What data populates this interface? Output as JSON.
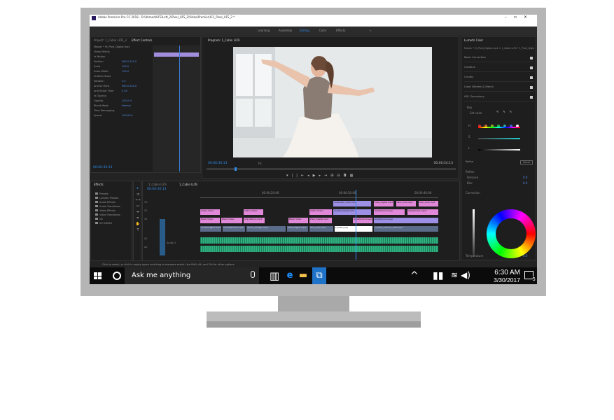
{
  "premiere": {
    "title": "Adobe Premiere Pro CC 2018 - D:\\Ahmed\\UFS\\Left_2\\Pixel_UFS_2\\Video\\Premier\\ICC_Pixel_UFS_2 *",
    "menu": [
      "File",
      "Edit",
      "Clip",
      "Sequence",
      "Markers",
      "Graphics",
      "Window",
      "Help"
    ],
    "workspaces": [
      "Learning",
      "Assembly",
      "Editing",
      "Color",
      "Effects"
    ],
    "active_workspace": "Editing",
    "effect_controls": {
      "tabs": [
        "Project: 1_Cabin LUTs_2",
        "Effect Controls"
      ],
      "source": "Master * Hi_Pixel_Digital.mp4",
      "sequence": "1_Cabin LUTs * 1_...",
      "clip_label": "Pixel_Digital_ICC.mp4",
      "rows": [
        {
          "label": "Video Effects",
          "value": ""
        },
        {
          "label": "fx Motion",
          "value": ""
        },
        {
          "label": "Position",
          "value": "960.0  540.0"
        },
        {
          "label": "Scale",
          "value": "100.0"
        },
        {
          "label": "Scale Width",
          "value": "100.0"
        },
        {
          "label": "Uniform Scale",
          "value": ""
        },
        {
          "label": "Rotation",
          "value": "0.0"
        },
        {
          "label": "Anchor Point",
          "value": "960.0  540.0"
        },
        {
          "label": "Anti-flicker Filter",
          "value": "0.00"
        },
        {
          "label": "fx Opacity",
          "value": ""
        },
        {
          "label": "Opacity",
          "value": "100.0 %"
        },
        {
          "label": "Blend Mode",
          "value": "Normal"
        },
        {
          "label": "Time Remapping",
          "value": ""
        },
        {
          "label": "Speed",
          "value": "100.00%"
        }
      ],
      "timecode": "00:00:30:13"
    },
    "program": {
      "tab": "Program: 1_Cabin LUTs",
      "timecode": "00:00:30:13",
      "fit": "Fit",
      "duration": "00:00:54:13"
    },
    "lumetri": {
      "tab": "Lumetri Color",
      "source": "Master * Hi_Pixel_Digital.mp4  >  1_Cabin LUTs * 1_Pixel_Digital",
      "sections": [
        "Basic Correction",
        "Creative",
        "Curves",
        "Color Wheels & Match",
        "HSL Secondary"
      ],
      "key_label": "Key",
      "set_color": "Set color",
      "hsl": [
        "H",
        "S",
        "L"
      ],
      "refine_label": "Refine",
      "denoise": "Denoise",
      "blur": "Blur",
      "correction": "Correction",
      "temperature": "Temperature",
      "color_reset": "Reset",
      "values": [
        "0.0",
        "0.0",
        "0.0"
      ]
    },
    "effects_panel": {
      "tab": "Effects",
      "items": [
        "Presets",
        "Lumetri Presets",
        "Audio Effects",
        "Audio Transitions",
        "Video Effects",
        "Video Transitions",
        "UX",
        "ICC MIXES"
      ]
    },
    "timeline": {
      "tabs": [
        "1_Cabin LUTs",
        "1_Cabin LUTs"
      ],
      "timecode": "00:00:30:13",
      "ruler": [
        "00:00:20:00",
        "00:00:30:00",
        "00:00:40:00"
      ],
      "tracks": [
        "V3",
        "V2",
        "V1",
        "A1",
        "A2"
      ],
      "track_audio_label": "Audio 1",
      "clips_v3": [
        "Cinematic_Color.mp4",
        "Pixel_Digital.mp4",
        "Skin_Tone.mp4",
        "Skin_Tone.mp4"
      ],
      "clips_v2": [
        "Cabin_Video",
        "Cabin_Video",
        "Cabin_Video",
        "Crystal_Adjust.mp4",
        "Adjustment Layer",
        "Adjustment Layer"
      ],
      "clips_v1": [
        "Black Video",
        "Black Video",
        "Clip_Nature.mp4",
        "Black Video",
        "Pixel_Digital.mp4",
        "Adjustment Layer",
        "Adjustment Layer"
      ],
      "clips_v0": [
        "LoveSongEnd.mp4",
        "CinemaFrame.mp4",
        "dance_footage.mp4",
        "Pixel_Digital.mp4",
        "Skin_Tone.mp4",
        "Lumetri_adj",
        "Lumetri_camera_final.mp4"
      ]
    },
    "status": "Click to select, or click in empty space and drag to marquee select. Use Shift, Alt, and Ctrl for other options."
  },
  "taskbar": {
    "search_placeholder": "Ask me anything",
    "time": "6:30 AM",
    "date": "3/30/2017",
    "notification_count": "5"
  }
}
